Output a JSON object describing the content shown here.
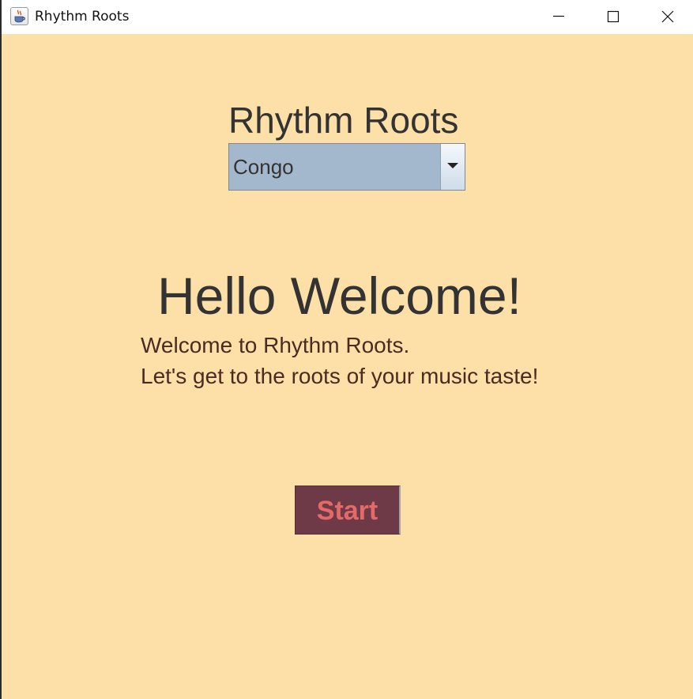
{
  "window": {
    "title": "Rhythm Roots",
    "icon": "java-cup-icon",
    "controls": [
      "minimize-icon",
      "maximize-icon",
      "close-icon"
    ]
  },
  "main": {
    "app_title": "Rhythm Roots",
    "dropdown": {
      "selected": "Congo",
      "icon": "chevron-down-icon"
    },
    "greeting": "Hello Welcome!",
    "message_line1": "Welcome to Rhythm Roots.",
    "message_line2": "Let's get to the roots of your music taste!",
    "start_label": "Start"
  },
  "colors": {
    "background": "#fde0a8",
    "dropdown_bg": "#a3b8cc",
    "button_bg": "#6e3a48",
    "button_text": "#e46a68",
    "text_dark": "#333333",
    "message_text": "#4a2b22"
  }
}
